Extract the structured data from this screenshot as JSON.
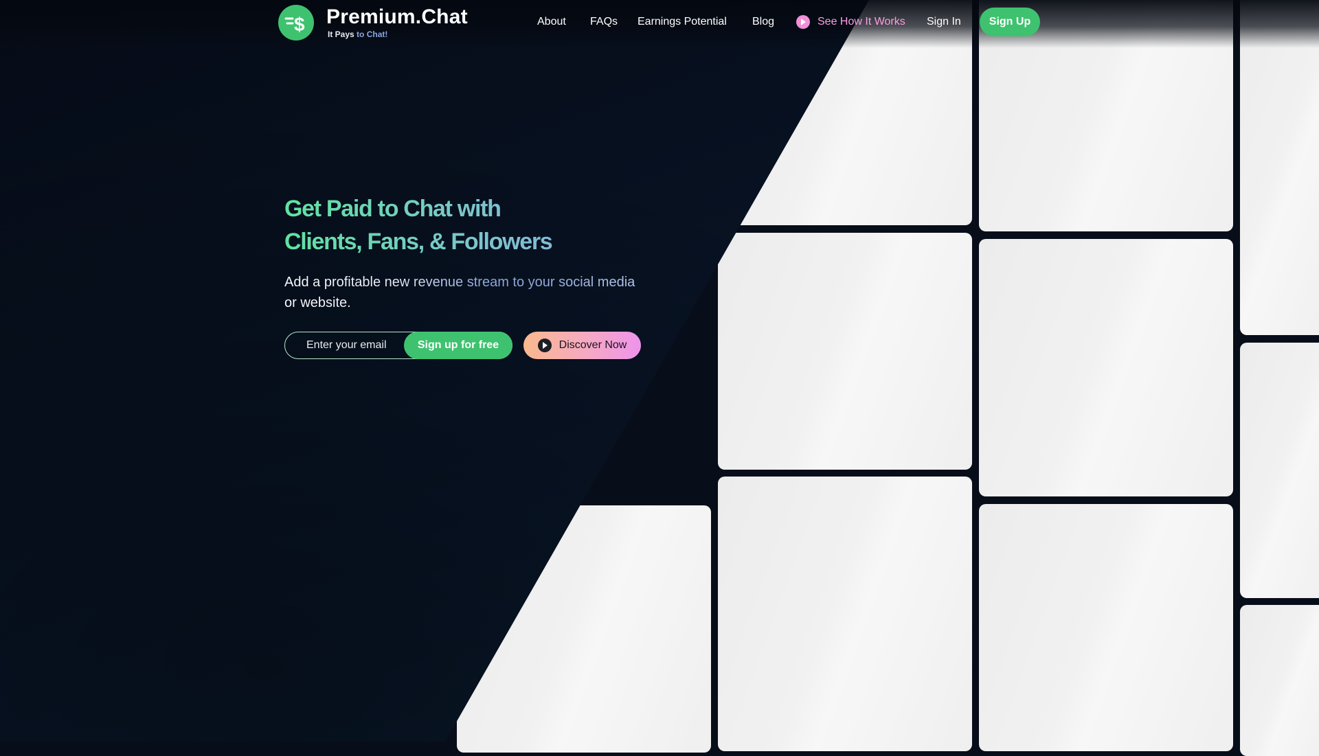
{
  "header": {
    "brand": "Premium.Chat",
    "tagline_main": "It Pays",
    "tagline_accent": "to Chat!",
    "logo_icon": "money-chat-icon",
    "nav": {
      "about": "About",
      "faqs": "FAQs",
      "earnings": "Earnings Potential",
      "blog": "Blog",
      "watch": "See How It Works",
      "signin": "Sign In"
    },
    "signup": "Sign Up"
  },
  "hero": {
    "headline_line1": "Get Paid to Chat with",
    "headline_line2": "Clients, Fans, & Followers",
    "subheading": "Add a profitable new revenue stream to your social media or website.",
    "email_placeholder": "Enter your email",
    "signup_free": "Sign up for free",
    "discover": "Discover Now"
  },
  "colors": {
    "background": "#080d1a",
    "brand_green": "#3ec26f",
    "watch_pink": "#ff9de4",
    "headline_gradient": [
      "#60e3a1",
      "#87a6e8"
    ],
    "discover_gradient": [
      "#f9b98d",
      "#ee93eb"
    ]
  }
}
